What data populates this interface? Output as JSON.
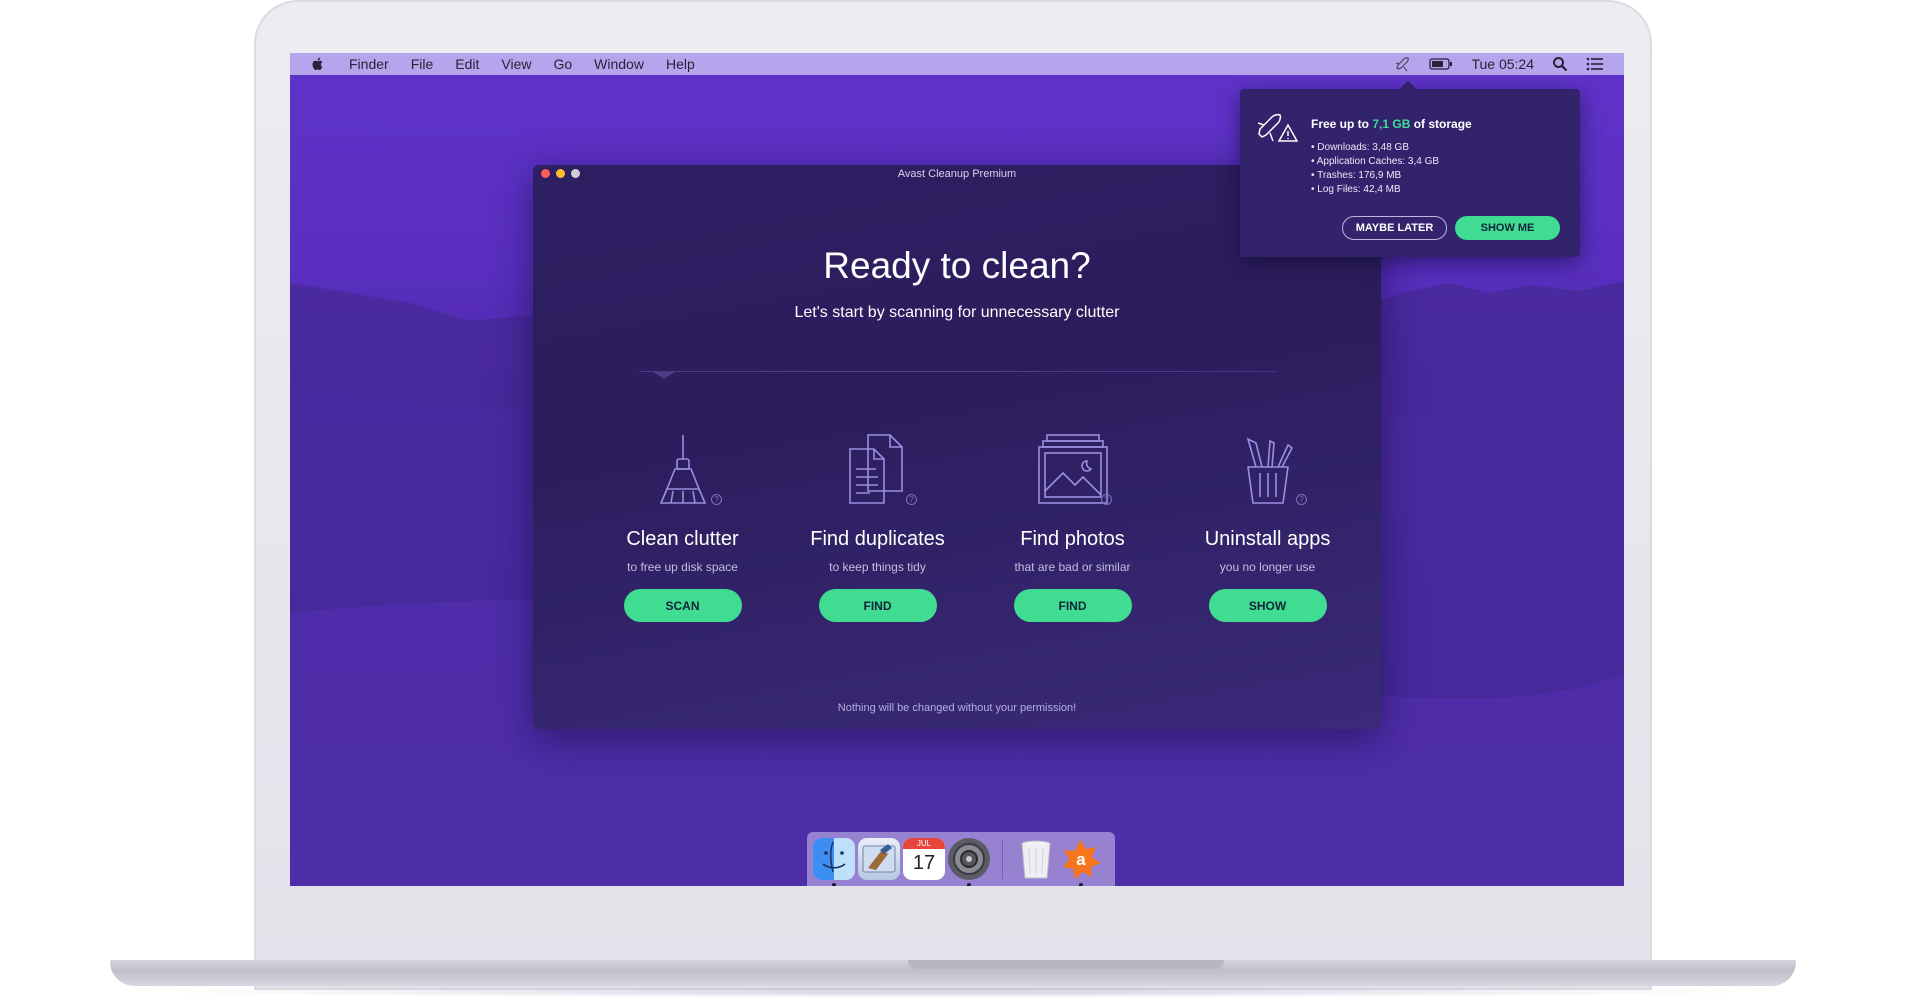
{
  "menubar": {
    "items": [
      "Finder",
      "File",
      "Edit",
      "View",
      "Go",
      "Window",
      "Help"
    ],
    "clock": "Tue 05:24"
  },
  "window": {
    "title": "Avast Cleanup Premium",
    "heading": "Ready to clean?",
    "subheading": "Let's start by scanning for unnecessary clutter",
    "footer": "Nothing will be changed without your permission!",
    "tiles": [
      {
        "icon": "broom-icon",
        "title": "Clean clutter",
        "subtitle": "to free up disk space",
        "button": "SCAN"
      },
      {
        "icon": "documents-icon",
        "title": "Find duplicates",
        "subtitle": "to keep things tidy",
        "button": "FIND"
      },
      {
        "icon": "photos-icon",
        "title": "Find photos",
        "subtitle": "that are bad or similar",
        "button": "FIND"
      },
      {
        "icon": "app-bin-icon",
        "title": "Uninstall apps",
        "subtitle": "you no longer use",
        "button": "SHOW"
      }
    ]
  },
  "popup": {
    "title_prefix": "Free up to ",
    "title_amount": "7,1 GB",
    "title_suffix": " of storage",
    "items": [
      "Downloads: 3,48 GB",
      "Application Caches: 3,4 GB",
      "Trashes: 176,9 MB",
      "Log Files: 42,4 MB"
    ],
    "secondary_button": "MAYBE LATER",
    "primary_button": "SHOW ME"
  },
  "dock": {
    "apps": [
      "finder-icon",
      "mail-icon",
      "calendar-icon",
      "system-preferences-icon",
      "trash-icon",
      "avast-icon"
    ],
    "calendar_month": "JUL",
    "calendar_day": "17"
  },
  "colors": {
    "accent": "#3fdc92",
    "window_bg": "#2e1f63",
    "desktop": "#5a2fc0",
    "menubar": "#b5a5ec"
  }
}
